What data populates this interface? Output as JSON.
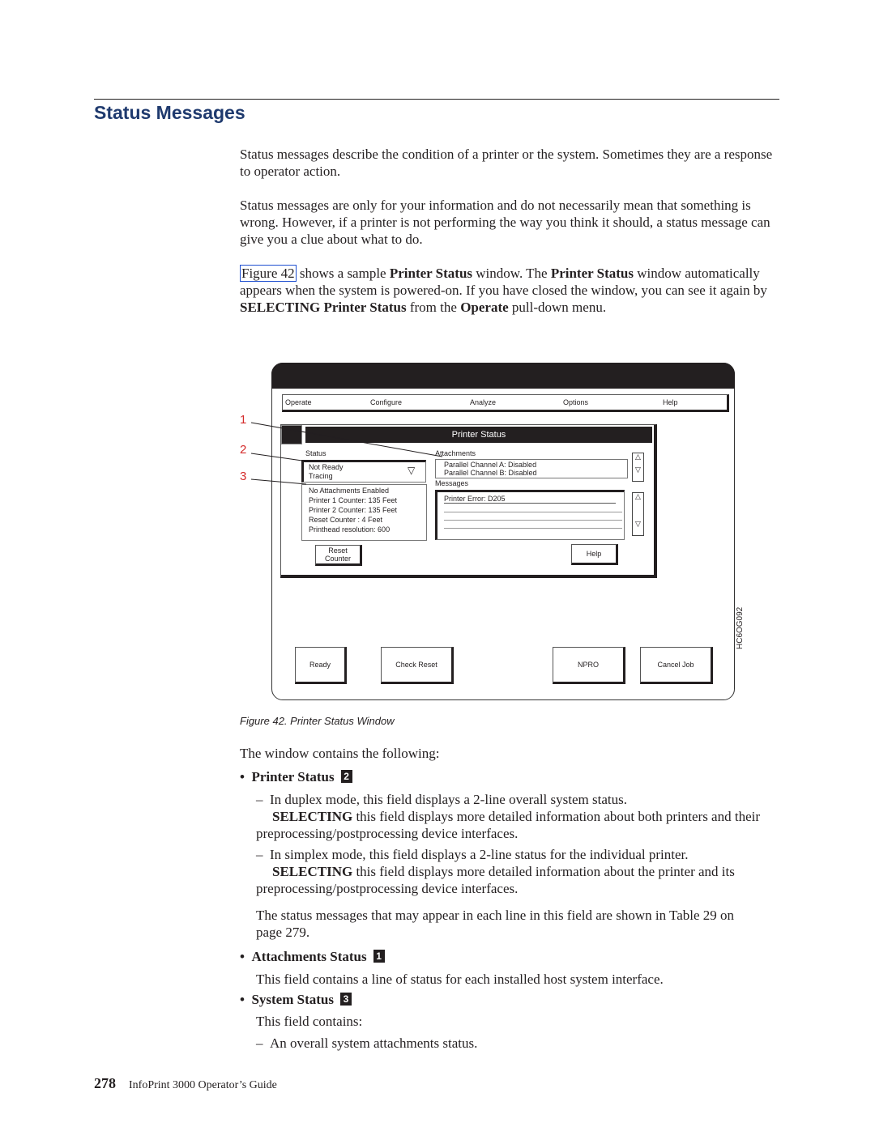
{
  "heading": "Status Messages",
  "paragraphs": [
    "Status messages describe the condition of a printer or the system. Sometimes they are a response to operator action.",
    "Status messages are only for your information and do not necessarily mean that something is wrong. However, if a printer is not performing the way you think it should, a status message can give you a clue about what to do."
  ],
  "para3": {
    "link": "Figure 42",
    "t1": " shows a sample ",
    "b1": "Printer Status",
    "t2": " window. The ",
    "b2": "Printer Status",
    "t3": " window automatically appears when the system is powered-on. If you have closed the window, you can see it again by ",
    "b3": "SELECTING Printer Status",
    "t4": " from the ",
    "b4": "Operate",
    "t5": " pull-down menu."
  },
  "figure": {
    "menu": [
      "Operate",
      "Configure",
      "Analyze",
      "Options",
      "Help"
    ],
    "dialog_title": "Printer Status",
    "status_label": "Status",
    "status_lines": [
      "Not Ready",
      "Tracing"
    ],
    "system_lines": [
      "No Attachments Enabled",
      "Printer 1 Counter: 135 Feet",
      "Printer 2 Counter: 135 Feet",
      "Reset Counter : 4 Feet",
      "Printhead resolution: 600"
    ],
    "attachments_label": "Attachments",
    "attachments": [
      "Parallel Channel A: Disabled",
      "Parallel Channel B: Disabled"
    ],
    "messages_label": "Messages",
    "messages": [
      "Printer Error: D205"
    ],
    "reset_counter": "Reset Counter",
    "help": "Help",
    "buttons": [
      "Ready",
      "Check Reset",
      "NPRO",
      "Cancel Job"
    ],
    "callouts": [
      "1",
      "2",
      "3"
    ],
    "figure_id": "HC6OG092",
    "up_arrow": "△",
    "down_arrow": "▽"
  },
  "caption": "Figure 42. Printer Status Window",
  "intro": "The window contains the following:",
  "items": [
    {
      "title": "Printer Status",
      "num": "2"
    },
    {
      "title": "Attachments Status",
      "num": "1"
    },
    {
      "title": "System Status",
      "num": "3"
    }
  ],
  "ps_dash1": "In duplex mode, this field displays a 2-line overall system status.",
  "ps_dash1b": "SELECTING",
  "ps_dash1c": " this field displays more detailed information about both printers and their preprocessing/postprocessing device interfaces.",
  "ps_dash2": "In simplex mode, this field displays a 2-line status for the individual printer.",
  "ps_dash2b": "SELECTING",
  "ps_dash2c": " this field displays more detailed information about the printer and its preprocessing/postprocessing device interfaces.",
  "ps_note": "The status messages that may appear in each line in this field are shown in Table 29 on page 279.",
  "att_text": "This field contains a line of status for each installed host system interface.",
  "sys_text": "This field contains:",
  "sys_dash": "An overall system attachments status.",
  "footer": {
    "page": "278",
    "title": "InfoPrint 3000 Operator’s Guide"
  }
}
